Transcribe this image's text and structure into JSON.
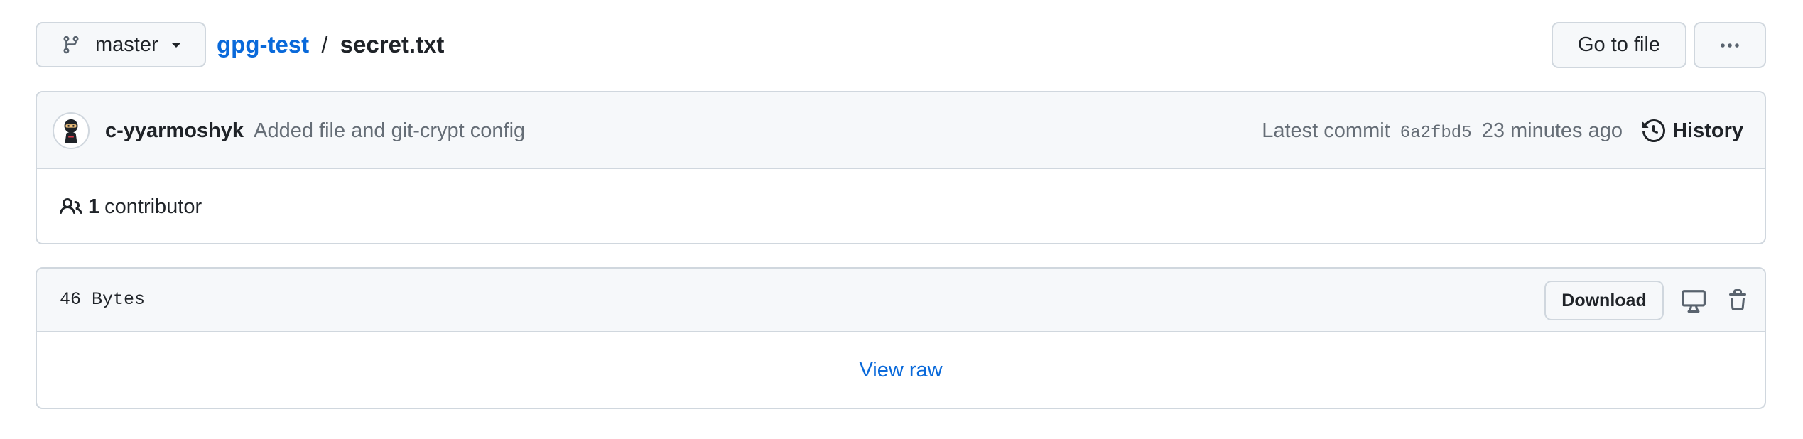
{
  "branch": {
    "name": "master",
    "icon": "git-branch-icon"
  },
  "breadcrumb": {
    "repo": "gpg-test",
    "separator": "/",
    "file": "secret.txt"
  },
  "actions": {
    "go_to_file": "Go to file",
    "more_icon": "kebab-horizontal-icon"
  },
  "commit": {
    "author": "c-yyarmoshyk",
    "message": "Added file and git-crypt config",
    "latest_label": "Latest commit",
    "sha": "6a2fbd5",
    "time": "23 minutes ago",
    "history_label": "History"
  },
  "contributors": {
    "count": "1",
    "label": "contributor"
  },
  "file": {
    "size": "46 Bytes",
    "download_label": "Download",
    "view_raw_label": "View raw"
  },
  "colors": {
    "link": "#0969da",
    "border": "#d0d7de",
    "header_bg": "#f6f8fa",
    "text": "#1f2328",
    "muted": "#656d76"
  }
}
